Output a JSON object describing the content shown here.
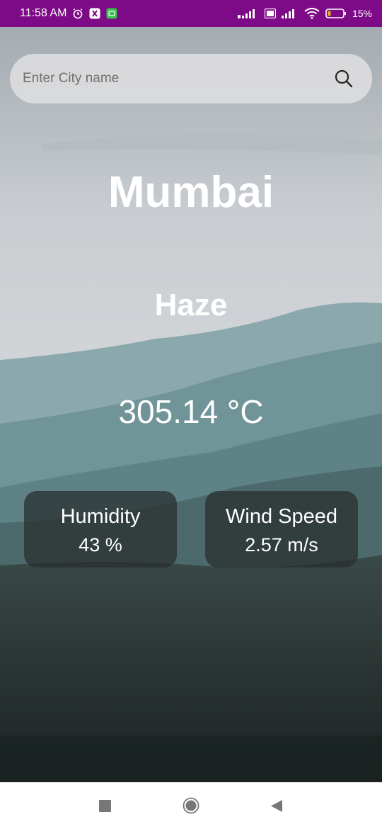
{
  "status_bar": {
    "time": "11:58 AM",
    "battery_percent": "15%"
  },
  "search": {
    "placeholder": "Enter City name"
  },
  "weather": {
    "city": "Mumbai",
    "condition": "Haze",
    "temperature": "305.14 °C",
    "humidity_label": "Humidity",
    "humidity_value": "43 %",
    "wind_label": "Wind Speed",
    "wind_value": "2.57 m/s"
  },
  "colors": {
    "status_bar": "#7d0a86",
    "search_bar": "#dcdcde",
    "card": "#282c2c",
    "text": "#ffffff"
  },
  "icons": {
    "search": "search-icon",
    "alarm": "alarm-icon",
    "wifi": "wifi-icon",
    "battery": "battery-icon",
    "nav_recent": "square-recent-apps-icon",
    "nav_home": "circle-home-icon",
    "nav_back": "triangle-back-icon"
  }
}
